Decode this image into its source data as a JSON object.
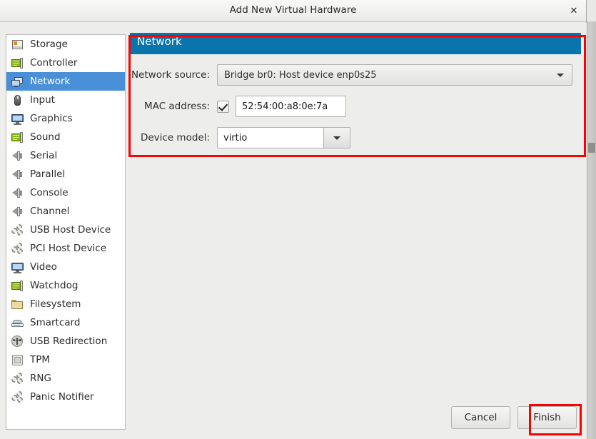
{
  "window": {
    "title": "Add New Virtual Hardware",
    "close_icon": "close-icon",
    "close_glyph": "✕"
  },
  "sidebar": {
    "items": [
      {
        "label": "Storage",
        "icon": "storage-icon",
        "selected": false
      },
      {
        "label": "Controller",
        "icon": "controller-card-icon",
        "selected": false
      },
      {
        "label": "Network",
        "icon": "network-icon",
        "selected": true
      },
      {
        "label": "Input",
        "icon": "mouse-icon",
        "selected": false
      },
      {
        "label": "Graphics",
        "icon": "monitor-icon",
        "selected": false
      },
      {
        "label": "Sound",
        "icon": "sound-card-icon",
        "selected": false
      },
      {
        "label": "Serial",
        "icon": "serial-port-icon",
        "selected": false
      },
      {
        "label": "Parallel",
        "icon": "parallel-port-icon",
        "selected": false
      },
      {
        "label": "Console",
        "icon": "console-port-icon",
        "selected": false
      },
      {
        "label": "Channel",
        "icon": "channel-port-icon",
        "selected": false
      },
      {
        "label": "USB Host Device",
        "icon": "gears-icon",
        "selected": false
      },
      {
        "label": "PCI Host Device",
        "icon": "gears-icon",
        "selected": false
      },
      {
        "label": "Video",
        "icon": "monitor-icon",
        "selected": false
      },
      {
        "label": "Watchdog",
        "icon": "watchdog-card-icon",
        "selected": false
      },
      {
        "label": "Filesystem",
        "icon": "folder-icon",
        "selected": false
      },
      {
        "label": "Smartcard",
        "icon": "smartcard-icon",
        "selected": false
      },
      {
        "label": "USB Redirection",
        "icon": "usb-icon",
        "selected": false
      },
      {
        "label": "TPM",
        "icon": "chip-icon",
        "selected": false
      },
      {
        "label": "RNG",
        "icon": "gears-icon",
        "selected": false
      },
      {
        "label": "Panic Notifier",
        "icon": "gears-icon",
        "selected": false
      }
    ]
  },
  "panel": {
    "header": "Network",
    "header_color": "#0a74ac",
    "selected_row_color": "#4a90d9",
    "fields": {
      "network_source": {
        "label": "Network source:",
        "value": "Bridge br0: Host device enp0s25",
        "dropdown_icon": "chevron-down-icon"
      },
      "mac_address": {
        "label": "MAC address:",
        "checked": true,
        "checkbox_icon": "checkmark-icon",
        "value": "52:54:00:a8:0e:7a"
      },
      "device_model": {
        "label": "Device model:",
        "value": "virtio",
        "dropdown_icon": "chevron-down-icon"
      }
    }
  },
  "footer": {
    "cancel_label": "Cancel",
    "finish_label": "Finish"
  },
  "annotations": {
    "color": "#fe0000",
    "boxes": [
      "network-panel-highlight",
      "finish-button-highlight"
    ]
  }
}
